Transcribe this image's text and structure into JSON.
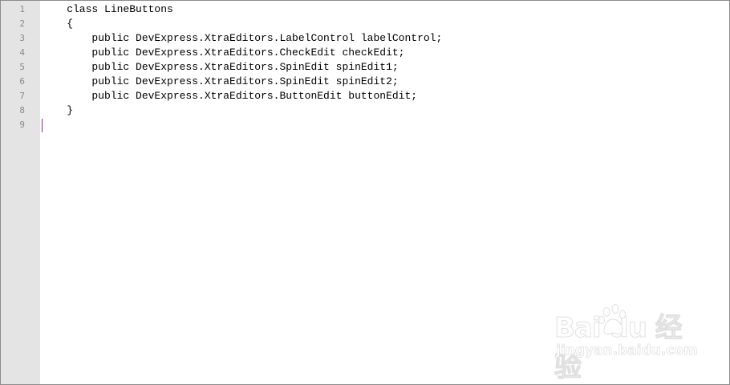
{
  "editor": {
    "line_numbers": [
      "1",
      "2",
      "3",
      "4",
      "5",
      "6",
      "7",
      "8",
      "9"
    ],
    "lines": [
      "    class LineButtons",
      "    {",
      "        public DevExpress.XtraEditors.LabelControl labelControl;",
      "        public DevExpress.XtraEditors.CheckEdit checkEdit;",
      "        public DevExpress.XtraEditors.SpinEdit spinEdit1;",
      "        public DevExpress.XtraEditors.SpinEdit spinEdit2;",
      "        public DevExpress.XtraEditors.ButtonEdit buttonEdit;",
      "    }",
      ""
    ],
    "caret_line": 9
  },
  "watermark": {
    "brand": "Bai  du 经验",
    "url": "jingyan.baidu.com",
    "icon": "baidu-paw-icon"
  },
  "colors": {
    "gutter_bg": "#e4e4e4",
    "line_number": "#8a8a8a",
    "caret": "#8b2a8b",
    "text": "#000000"
  }
}
